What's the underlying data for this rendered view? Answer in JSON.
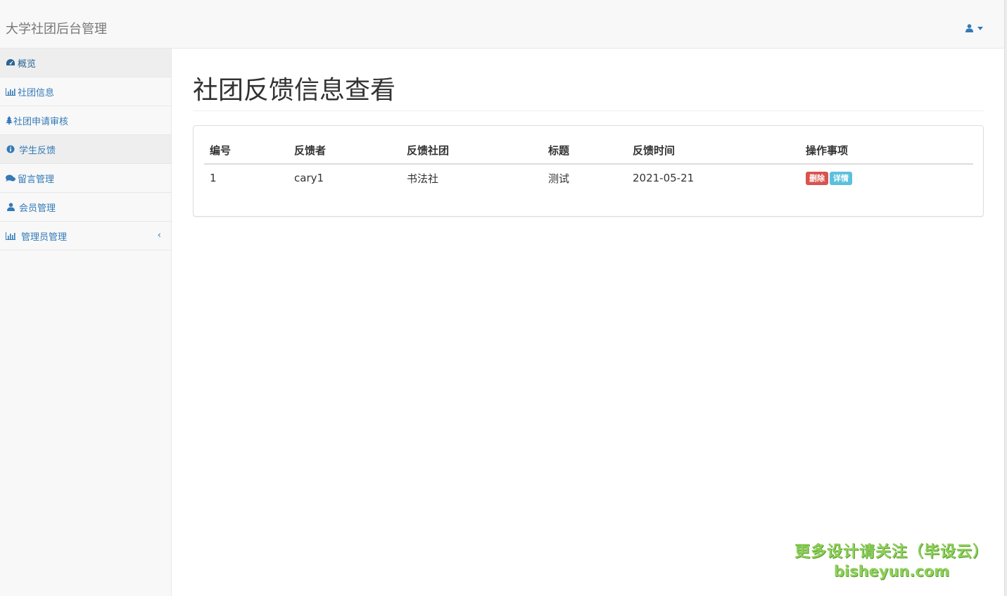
{
  "app": {
    "brand": "大学社团后台管理"
  },
  "sidebar": {
    "items": [
      {
        "label": "概览",
        "icon": "dashboard-icon"
      },
      {
        "label": "社团信息",
        "icon": "bar-chart-icon"
      },
      {
        "label": "社团申请审核",
        "icon": "tree-icon"
      },
      {
        "label": "学生反馈",
        "icon": "info-circle-icon"
      },
      {
        "label": "留言管理",
        "icon": "comments-icon"
      },
      {
        "label": "会员管理",
        "icon": "user-icon"
      },
      {
        "label": "管理员管理",
        "icon": "bar-chart-icon"
      }
    ]
  },
  "main": {
    "title": "社团反馈信息查看",
    "table": {
      "headers": [
        "编号",
        "反馈者",
        "反馈社团",
        "标题",
        "反馈时间",
        "操作事项"
      ],
      "rows": [
        {
          "id": "1",
          "user": "cary1",
          "club": "书法社",
          "title": "测试",
          "time": "2021-05-21"
        }
      ],
      "actions": {
        "delete": "删除",
        "detail": "详情"
      }
    }
  },
  "watermark": {
    "line1": "更多设计请关注（毕设云）",
    "line2": "bisheyun.com"
  },
  "colors": {
    "link": "#337ab7",
    "danger": "#d9534f",
    "info": "#5bc0de"
  }
}
